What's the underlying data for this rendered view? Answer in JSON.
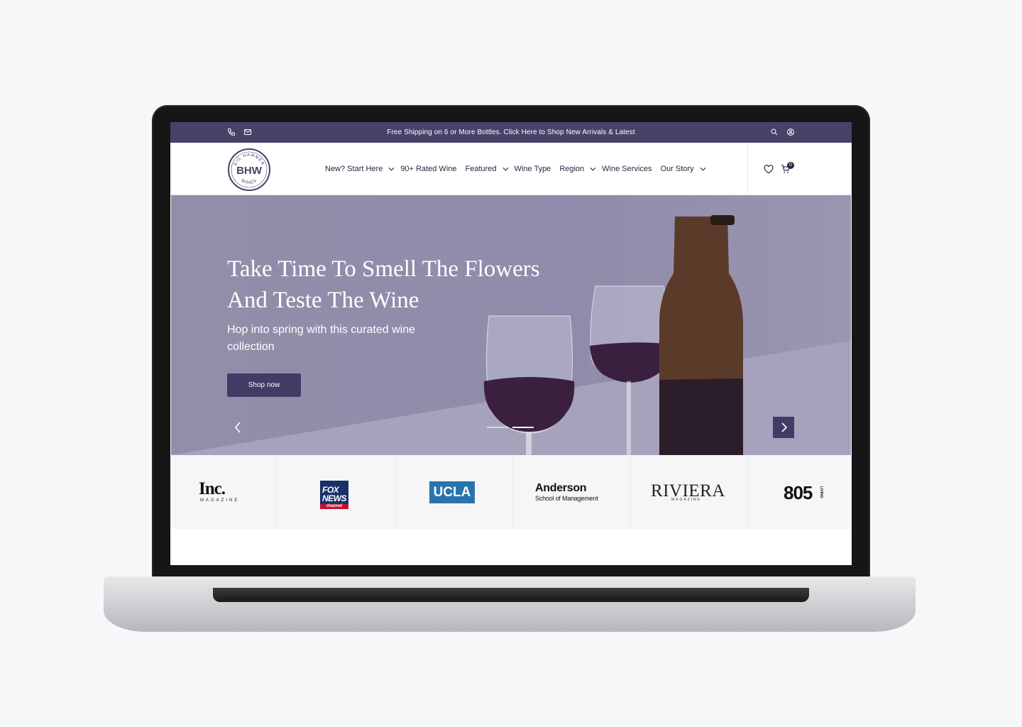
{
  "announcement": {
    "text": "Free Shipping on 6 or More Bottles. Click Here to Shop New Arrivals & Latest"
  },
  "nav": {
    "items": [
      {
        "label": "New? Start Here",
        "has_dropdown": true
      },
      {
        "label": "90+ Rated Wine",
        "has_dropdown": false
      },
      {
        "label": "Featured",
        "has_dropdown": true
      },
      {
        "label": "Wine Type",
        "has_dropdown": false
      },
      {
        "label": "Region",
        "has_dropdown": true
      },
      {
        "label": "Wine Services",
        "has_dropdown": false
      },
      {
        "label": "Our Story",
        "has_dropdown": true
      }
    ],
    "cart_count": "0"
  },
  "logo": {
    "arc_top": "BIG HAMMER",
    "letters": "BHW",
    "arc_bottom": "WINES"
  },
  "hero": {
    "title_line1": "Take Time To Smell The Flowers",
    "title_line2": "And Teste The Wine",
    "subtitle": "Hop into spring with this curated wine collection",
    "button_label": "Shop now"
  },
  "press": {
    "inc": {
      "main": "Inc.",
      "sub": "MAGAZINE"
    },
    "fox": {
      "top": "FOX",
      "mid": "NEWS",
      "bar": "channel"
    },
    "ucla": {
      "label": "UCLA"
    },
    "anderson": {
      "main": "Anderson",
      "sub": "School of Management"
    },
    "riviera": {
      "main": "RIVIERA",
      "sub": "MAGAZINE"
    },
    "n805": {
      "main": "805",
      "sub": "LIVING"
    }
  },
  "colors": {
    "brand": "#4a4169",
    "button": "#433a66",
    "hero_bg": "#8e8aa8"
  },
  "icons": [
    "phone-icon",
    "mail-icon",
    "search-icon",
    "user-icon",
    "heart-icon",
    "cart-icon",
    "chevron-left-icon",
    "chevron-right-icon",
    "chevron-down-icon"
  ]
}
